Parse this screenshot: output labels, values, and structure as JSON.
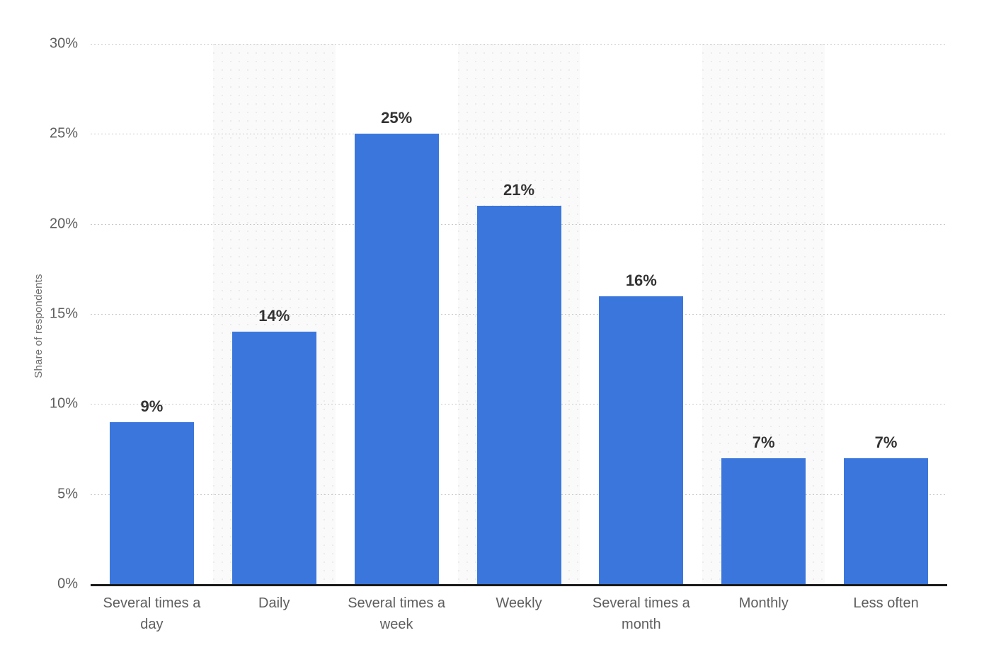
{
  "chart_data": {
    "type": "bar",
    "title": "",
    "subtitle": "",
    "xlabel": "",
    "ylabel": "Share of respondents",
    "categories": [
      "Several times a day",
      "Daily",
      "Several times a week",
      "Weekly",
      "Several times a month",
      "Monthly",
      "Less often"
    ],
    "values": [
      9,
      14,
      25,
      21,
      16,
      7,
      7
    ],
    "data_labels": [
      "9%",
      "14%",
      "25%",
      "21%",
      "16%",
      "7%",
      "7%"
    ],
    "ylim": [
      0,
      30
    ],
    "y_tick_values": [
      0,
      5,
      10,
      15,
      20,
      25,
      30
    ],
    "y_tick_labels": [
      "0%",
      "5%",
      "10%",
      "15%",
      "20%",
      "25%",
      "30%"
    ],
    "grid": "horizontal-dotted",
    "legend": "none",
    "bar_color": "#3b76dc",
    "band_color": "#fafafa",
    "gridline_color": "#c9c9c9",
    "axis_color": "#1a1a1a",
    "label_color": "#5e5e5e",
    "value_label_color": "#333333"
  }
}
